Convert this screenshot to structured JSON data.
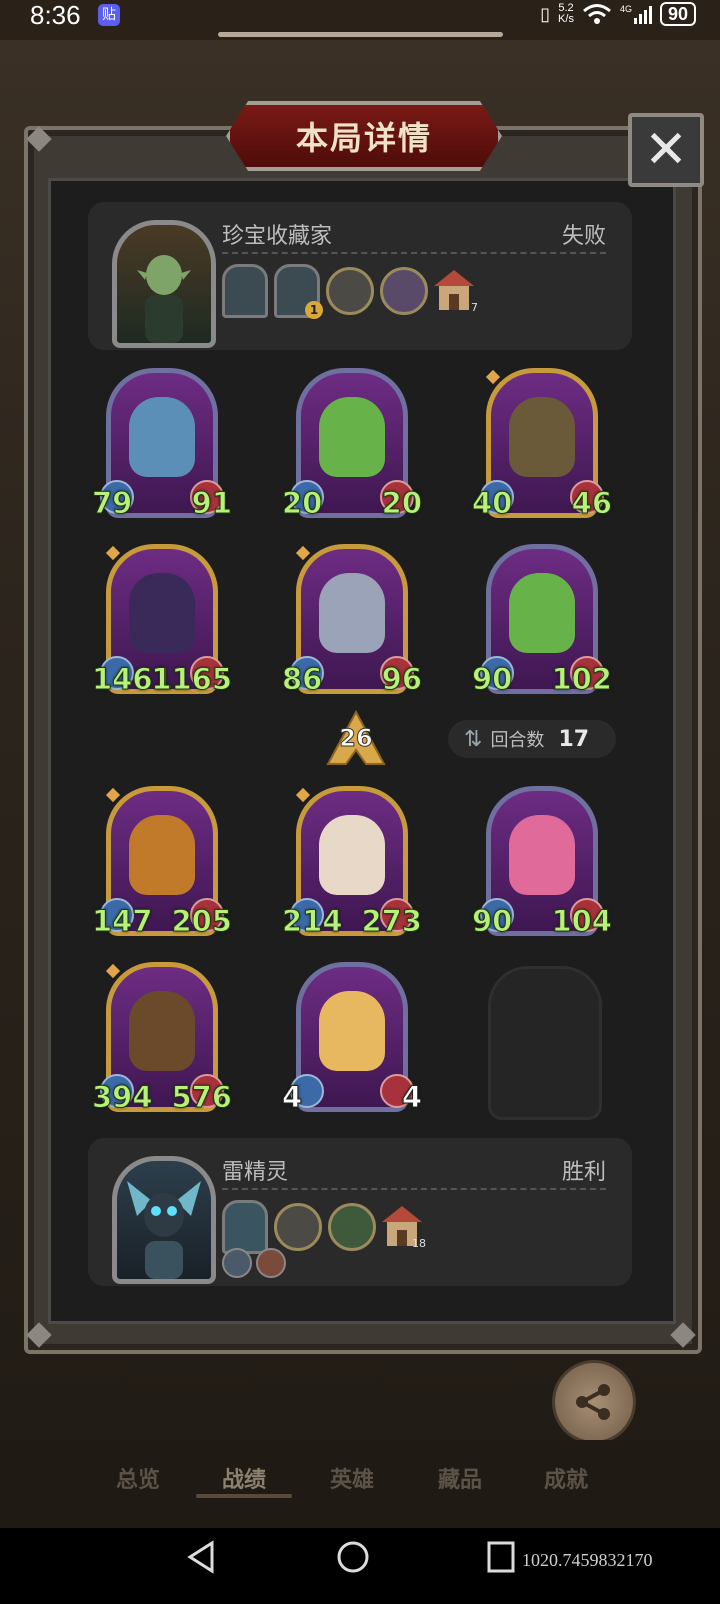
{
  "status_bar": {
    "time": "8:36",
    "app_badge": "贴",
    "net_speed_value": "5.2",
    "net_speed_unit": "K/s",
    "network": "4G",
    "battery": "90"
  },
  "dialog": {
    "title": "本局详情",
    "close_icon": "close-icon"
  },
  "opponent": {
    "name": "珍宝收藏家",
    "result": "失败",
    "house_count": "7",
    "badge_count": "1"
  },
  "units_top": [
    {
      "atk": "79",
      "hp": "91",
      "frame": "purple",
      "art": "elf-sorceress"
    },
    {
      "atk": "20",
      "hp": "20",
      "frame": "purple",
      "art": "apple-frog"
    },
    {
      "atk": "40",
      "hp": "46",
      "frame": "gold",
      "art": "bandit-archer"
    },
    {
      "atk": "1461",
      "hp": "1165",
      "frame": "gold",
      "art": "shadow-dragon"
    },
    {
      "atk": "86",
      "hp": "96",
      "frame": "gold",
      "art": "armored-knight"
    },
    {
      "atk": "90",
      "hp": "102",
      "frame": "purple",
      "art": "apple-frog"
    }
  ],
  "units_bottom": [
    {
      "atk": "147",
      "hp": "205",
      "frame": "gold",
      "art": "pumpkin-monster"
    },
    {
      "atk": "214",
      "hp": "273",
      "frame": "gold",
      "art": "chef"
    },
    {
      "atk": "90",
      "hp": "104",
      "frame": "purple",
      "art": "rose-lady"
    },
    {
      "atk": "394",
      "hp": "576",
      "frame": "gold",
      "art": "tiki-totem"
    },
    {
      "atk": "4",
      "hp": "4",
      "frame": "purple",
      "art": "hamster"
    }
  ],
  "tier": "26",
  "rounds": {
    "label": "回合数",
    "value": "17"
  },
  "player": {
    "name": "雷精灵",
    "result": "胜利",
    "house_count": "18"
  },
  "share": {
    "label": "分享"
  },
  "tabs": [
    "总览",
    "战绩",
    "英雄",
    "藏品",
    "成就"
  ],
  "active_tab": 1,
  "coords_text": "1020.7459832170",
  "colors": {
    "title_plaque": "#6a1512",
    "stat_green": "#b8f07a",
    "gold_frame": "#c79a3b",
    "purple_frame": "#6f6fa0"
  }
}
